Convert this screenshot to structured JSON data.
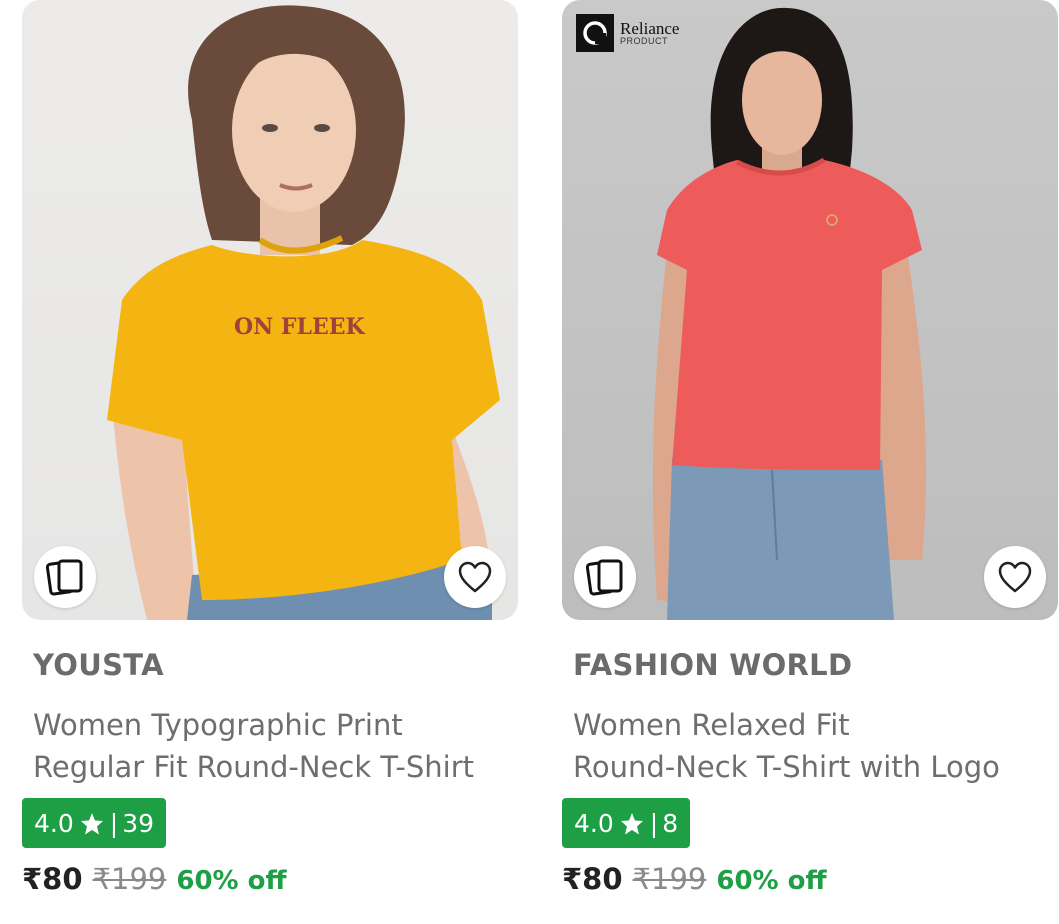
{
  "products": [
    {
      "brand": "YOUSTA",
      "title_line1": "Women Typographic Print",
      "title_line2": "Regular Fit Round-Neck T-Shirt",
      "print_text": "ON FLEEK",
      "rating": "4.0",
      "reviews": "39",
      "price": "₹80",
      "mrp": "₹199",
      "discount": "60% off",
      "shirt_color": "#f4b513"
    },
    {
      "brand_badge_line1": "Reliance",
      "brand_badge_line2": "PRODUCT",
      "brand": "FASHION WORLD",
      "title_line1": "Women Relaxed Fit",
      "title_line2": "Round-Neck T-Shirt with Logo",
      "rating": "4.0",
      "reviews": "8",
      "price": "₹80",
      "mrp": "₹199",
      "discount": "60% off",
      "shirt_color": "#ee5b5b"
    }
  ],
  "icons": {
    "compare": "compare-cards-icon",
    "wishlist": "heart-outline-icon",
    "rating_star": "star-icon"
  },
  "colors": {
    "rating_badge": "#1e9e45",
    "discount": "#1e9e45"
  }
}
